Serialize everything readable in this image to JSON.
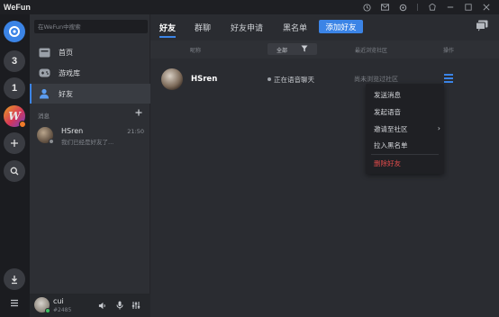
{
  "app": {
    "title": "WeFun"
  },
  "rail": {
    "badge_1": "3",
    "badge_2": "1",
    "w_letter": "W"
  },
  "sidebar": {
    "search_placeholder": "在WeFun中搜索",
    "nav": [
      {
        "label": "首页",
        "icon": "home-icon"
      },
      {
        "label": "游戏库",
        "icon": "gamepad-icon"
      },
      {
        "label": "好友",
        "icon": "friends-icon"
      }
    ],
    "messages_title": "消息",
    "messages": [
      {
        "name": "HSren",
        "time": "21:50",
        "preview": "我们已经是好友了..."
      }
    ],
    "user": {
      "name": "cui",
      "tag": "#2485"
    }
  },
  "main": {
    "tabs": [
      "好友",
      "群聊",
      "好友申请",
      "黑名单"
    ],
    "add_friend_label": "添加好友",
    "columns": {
      "name": "昵称",
      "filter_value": "全部",
      "community": "最近浏览社区",
      "actions": "操作"
    },
    "friends": [
      {
        "name": "HSren",
        "status": "正在语音聊天",
        "community": "尚未浏览过社区"
      }
    ],
    "context_menu": [
      "发送消息",
      "发起语音",
      "邀请至社区",
      "拉入黑名单",
      "删除好友"
    ]
  },
  "colors": {
    "accent": "#3b84e6",
    "danger": "#e14b4b",
    "bg": "#2a2c31"
  }
}
